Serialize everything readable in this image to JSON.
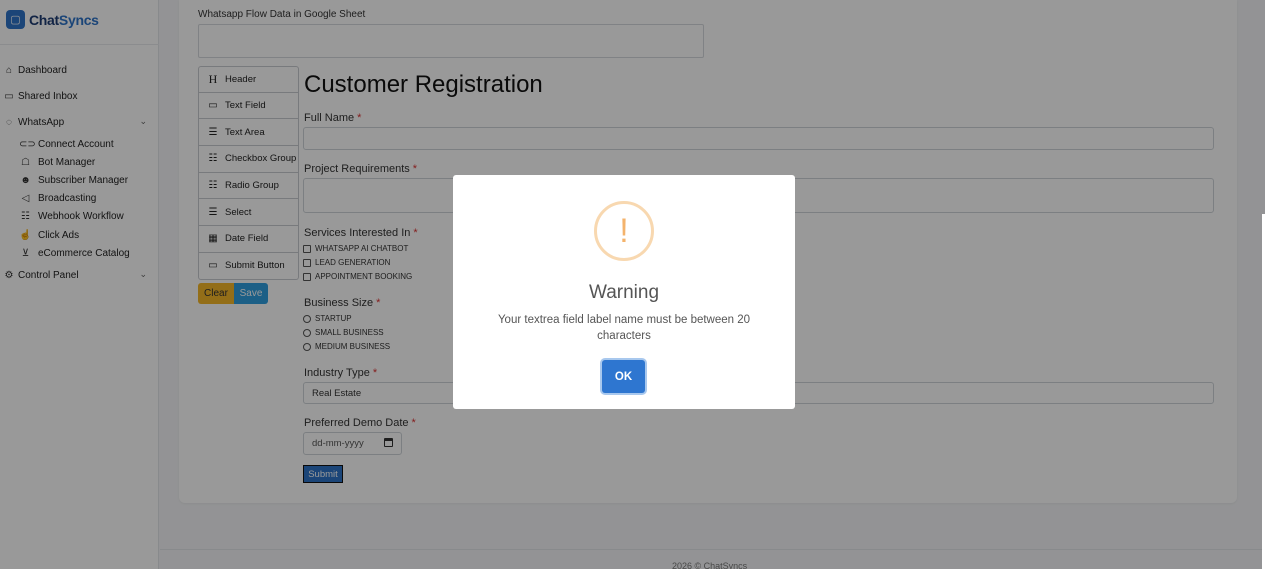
{
  "brand": {
    "name_part1": "Chat",
    "name_part2": "Syncs",
    "logo_icon": "chat-bubble-icon"
  },
  "sidebar": {
    "items": [
      {
        "label": "Dashboard",
        "icon": "home-icon"
      },
      {
        "label": "Shared Inbox",
        "icon": "inbox-icon"
      },
      {
        "label": "WhatsApp",
        "icon": "whatsapp-icon",
        "expanded": true,
        "children": [
          {
            "label": "Connect Account",
            "icon": "link-icon"
          },
          {
            "label": "Bot Manager",
            "icon": "robot-icon"
          },
          {
            "label": "Subscriber Manager",
            "icon": "users-icon"
          },
          {
            "label": "Broadcasting",
            "icon": "megaphone-icon"
          },
          {
            "label": "Webhook Workflow",
            "icon": "workflow-icon"
          },
          {
            "label": "Click Ads",
            "icon": "click-icon"
          },
          {
            "label": "eCommerce Catalog",
            "icon": "cart-icon"
          }
        ]
      },
      {
        "label": "Control Panel",
        "icon": "gear-icon"
      }
    ]
  },
  "main": {
    "sheet_label": "Whatsapp Flow Data in Google Sheet",
    "sheet_value": "",
    "palette": [
      {
        "label": "Header",
        "icon": "header-icon"
      },
      {
        "label": "Text Field",
        "icon": "text-field-icon"
      },
      {
        "label": "Text Area",
        "icon": "text-area-icon"
      },
      {
        "label": "Checkbox Group",
        "icon": "checkbox-group-icon"
      },
      {
        "label": "Radio Group",
        "icon": "radio-group-icon"
      },
      {
        "label": "Select",
        "icon": "select-icon"
      },
      {
        "label": "Date Field",
        "icon": "calendar-icon"
      },
      {
        "label": "Submit Button",
        "icon": "submit-button-icon"
      }
    ],
    "clear_label": "Clear",
    "save_label": "Save"
  },
  "form": {
    "title": "Customer Registration",
    "full_name_label": "Full Name",
    "project_label": "Project Requirements",
    "services_label": "Services Interested In",
    "services_options": [
      "WHATSAPP AI CHATBOT",
      "LEAD GENERATION",
      "APPOINTMENT BOOKING"
    ],
    "business_label": "Business Size",
    "business_options": [
      "STARTUP",
      "SMALL BUSINESS",
      "MEDIUM BUSINESS"
    ],
    "industry_label": "Industry Type",
    "industry_value": "Real Estate",
    "demo_label": "Preferred Demo Date",
    "demo_placeholder": "dd-mm-yyyy",
    "submit_label": "Submit",
    "required_mark": "*"
  },
  "footer": {
    "text": "2026 © ChatSyncs"
  },
  "dialog": {
    "icon": "!",
    "title": "Warning",
    "message": "Your textrea field label name must be between 20 characters",
    "ok_label": "OK"
  },
  "colors": {
    "brand_dark": "#1f3d74",
    "brand": "#2e74c8",
    "clear": "#f5b829",
    "save": "#2f9fe0",
    "warning": "#f4b36c"
  }
}
